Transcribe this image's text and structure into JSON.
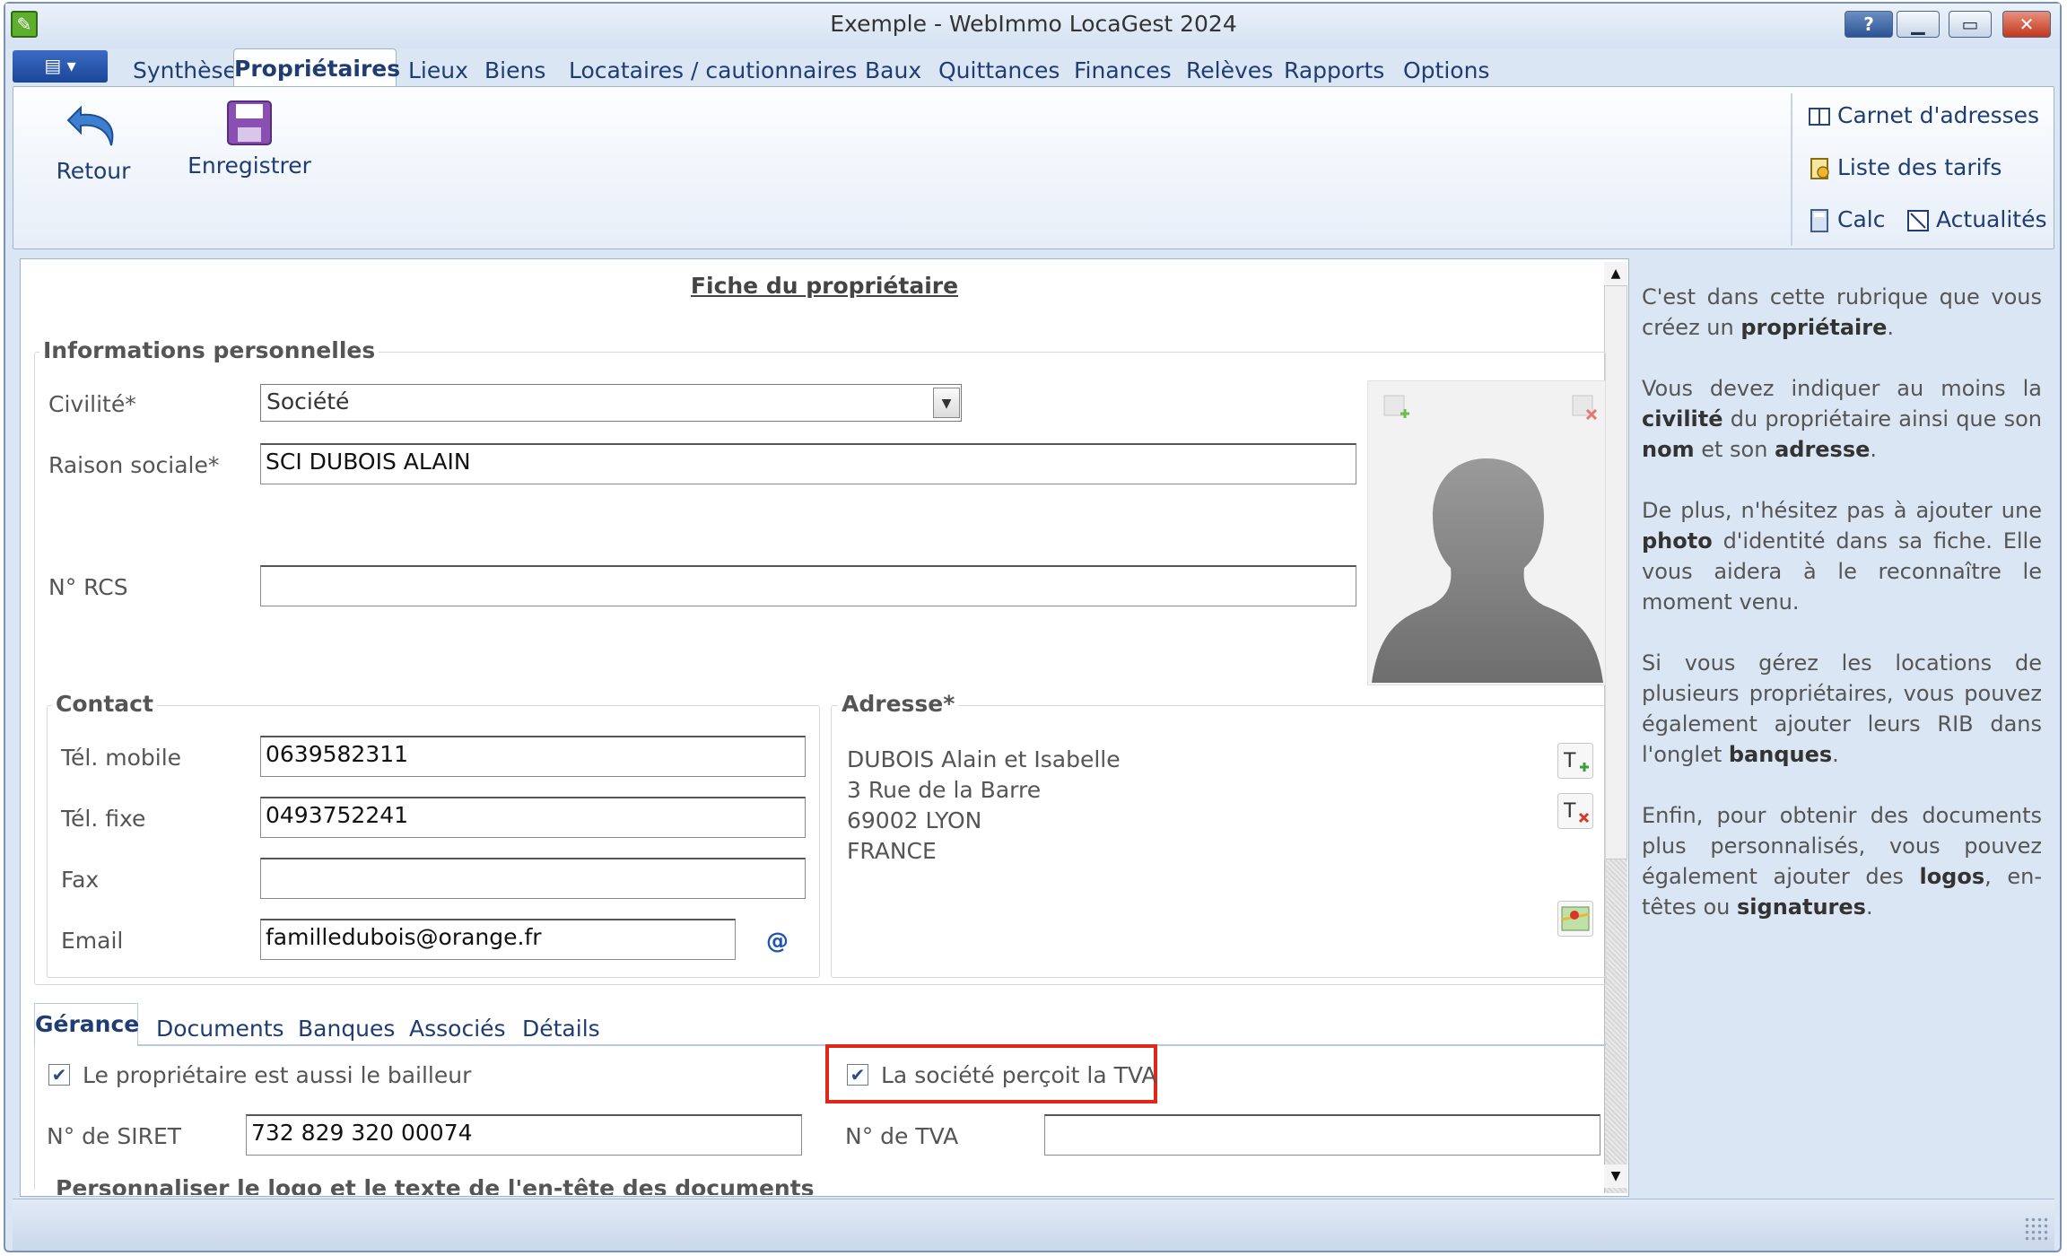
{
  "window": {
    "title": "Exemple - WebImmo LocaGest 2024",
    "help_label": "?",
    "min_label": "▁",
    "max_label": "▭",
    "close_label": "✕"
  },
  "ribbon": {
    "menu_label": "▤ ▾",
    "tabs": [
      "Synthèse",
      "Propriétaires",
      "Lieux",
      "Biens",
      "Locataires / cautionnaires",
      "Baux",
      "Quittances",
      "Finances",
      "Relèves",
      "Rapports",
      "Options"
    ],
    "active_tab": "Propriétaires",
    "retour": "Retour",
    "enregistrer": "Enregistrer",
    "carnet": "Carnet d'adresses",
    "tarifs": "Liste des tarifs",
    "calc": "Calc",
    "actualites": "Actualités"
  },
  "fiche": {
    "title": "Fiche du propriétaire",
    "infos_title": "Informations personnelles",
    "civilite_label": "Civilité*",
    "civilite_value": "Société",
    "raison_label": "Raison sociale*",
    "raison_value": "SCI DUBOIS ALAIN",
    "rcs_label": "N° RCS",
    "rcs_value": "",
    "contact_title": "Contact",
    "mobile_label": "Tél. mobile",
    "mobile_value": "0639582311",
    "fixe_label": "Tél. fixe",
    "fixe_value": "0493752241",
    "fax_label": "Fax",
    "fax_value": "",
    "email_label": "Email",
    "email_value": "familledubois@orange.fr",
    "email_at": "@",
    "adresse_title": "Adresse*",
    "adresse_lines": [
      "DUBOIS Alain et Isabelle",
      "3 Rue de la Barre",
      "69002 LYON",
      "FRANCE"
    ]
  },
  "gerance": {
    "tabs": [
      "Gérance",
      "Documents",
      "Banques",
      "Associés",
      "Détails"
    ],
    "bailleur_label": "Le propriétaire est aussi le bailleur",
    "bailleur_checked": true,
    "tva_label": "La société perçoit la TVA",
    "tva_checked": true,
    "siret_label": "N° de SIRET",
    "siret_value": "732 829 320 00074",
    "ntva_label": "N° de TVA",
    "ntva_value": "",
    "perso_title": "Personnaliser le logo et le texte de l'en-tête des documents"
  },
  "help": {
    "p1_a": "C'est dans cette rubrique que vous créez un ",
    "p1_b": "propriétaire",
    "p1_c": ".",
    "p2_a": "Vous devez indiquer au moins la ",
    "p2_b": "civilité",
    "p2_c": " du propriétaire ainsi que son ",
    "p2_d": "nom",
    "p2_e": " et son ",
    "p2_f": "adresse",
    "p2_g": ".",
    "p3_a": "De plus, n'hésitez pas à ajouter une ",
    "p3_b": "photo",
    "p3_c": " d'identité dans sa fiche. Elle vous aidera à le reconnaître le moment venu.",
    "p4_a": "Si vous gérez les locations de plusieurs propriétaires, vous pouvez également ajouter leurs RIB dans l'onglet ",
    "p4_b": "banques",
    "p4_c": ".",
    "p5_a": "Enfin, pour obtenir des documents plus personnalisés, vous pouvez également ajouter des ",
    "p5_b": "logos",
    "p5_c": ", en-têtes ou ",
    "p5_d": "signatures",
    "p5_e": "."
  },
  "colors": {
    "accent": "#1f3d72",
    "highlight": "#e0281a",
    "titlebar": "#dbe6f4"
  }
}
